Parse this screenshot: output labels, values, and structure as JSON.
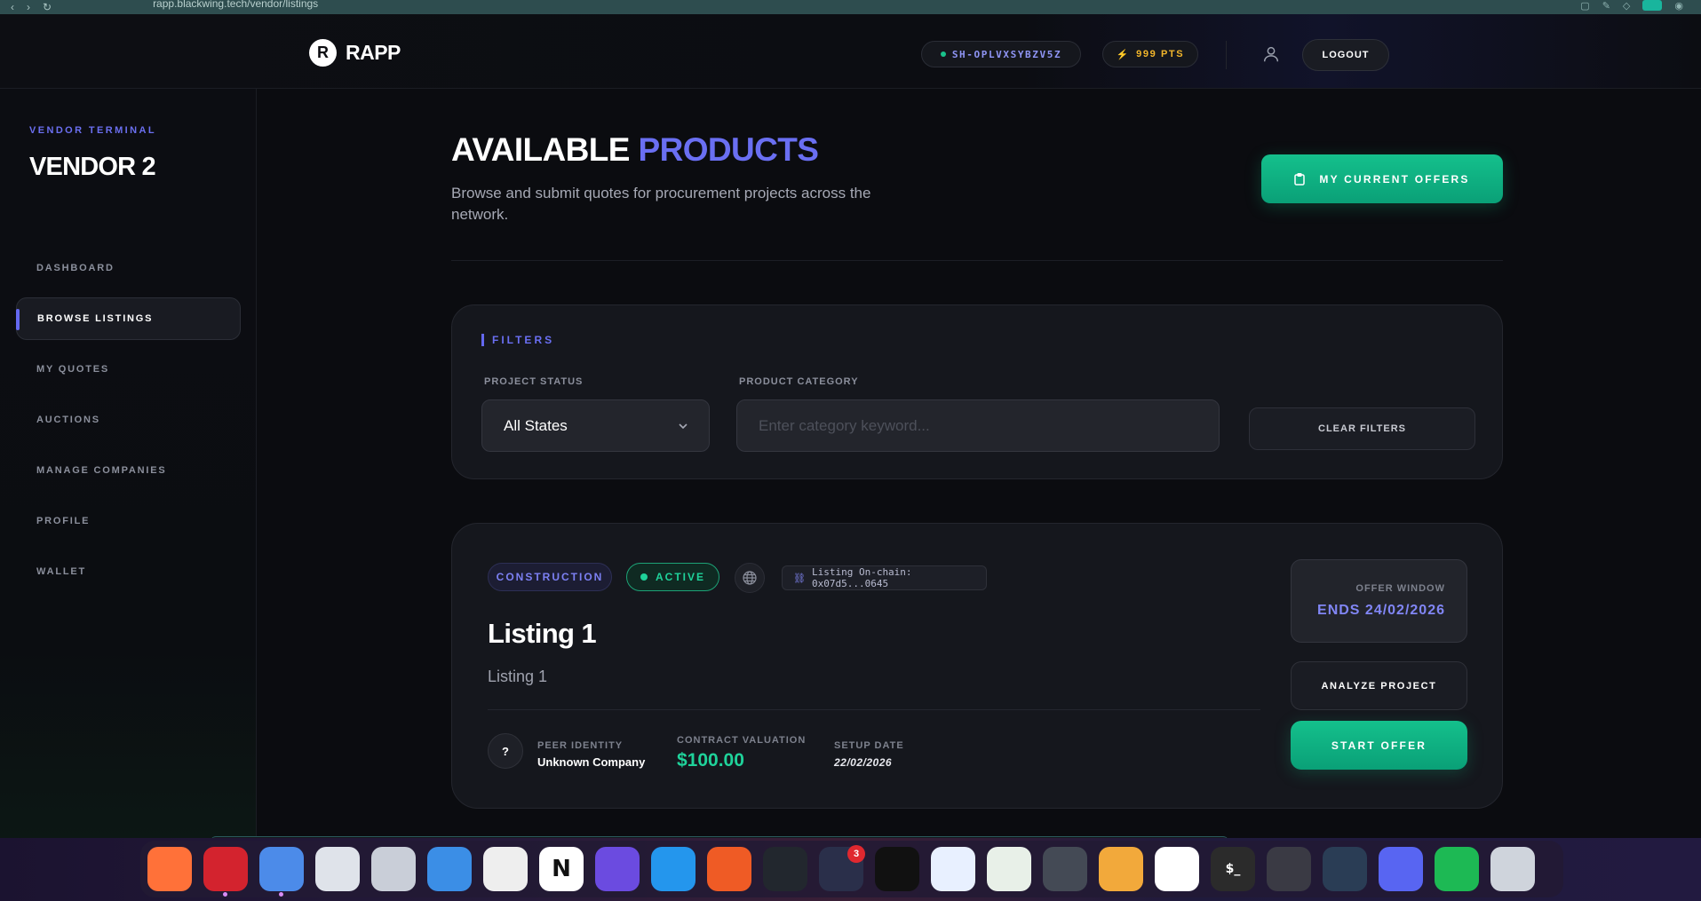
{
  "browser": {
    "url": "rapp.blackwing.tech/vendor/listings"
  },
  "topnav": {
    "brand_letter": "R",
    "brand_name": "RAPP",
    "session_id": "SH-OPLVXSYBZV5Z",
    "points": "999 PTS",
    "logout_label": "LOGOUT"
  },
  "sidebar": {
    "section_label": "VENDOR TERMINAL",
    "vendor_name": "VENDOR 2",
    "items": [
      {
        "label": "DASHBOARD",
        "active": false
      },
      {
        "label": "BROWSE LISTINGS",
        "active": true
      },
      {
        "label": "MY QUOTES",
        "active": false
      },
      {
        "label": "AUCTIONS",
        "active": false
      },
      {
        "label": "MANAGE COMPANIES",
        "active": false
      },
      {
        "label": "PROFILE",
        "active": false
      },
      {
        "label": "WALLET",
        "active": false
      }
    ]
  },
  "page": {
    "title_main": "AVAILABLE",
    "title_accent": "PRODUCTS",
    "subtitle": "Browse and submit quotes for procurement projects across the network.",
    "offers_button": "MY CURRENT OFFERS"
  },
  "filters": {
    "label": "FILTERS",
    "status_label": "PROJECT STATUS",
    "status_value": "All States",
    "category_label": "PRODUCT CATEGORY",
    "category_placeholder": "Enter category keyword...",
    "clear_label": "CLEAR FILTERS"
  },
  "listing": {
    "category": "CONSTRUCTION",
    "status": "ACTIVE",
    "chain": "Listing On-chain: 0x07d5...0645",
    "title": "Listing 1",
    "description": "Listing 1",
    "peer_label": "PEER IDENTITY",
    "peer_value": "Unknown Company",
    "peer_avatar": "?",
    "valuation_label": "CONTRACT VALUATION",
    "valuation_value": "$100.00",
    "setup_label": "SETUP DATE",
    "setup_value": "22/02/2026",
    "offer_window_label": "OFFER WINDOW",
    "offer_window_value": "ENDS 24/02/2026",
    "analyze_label": "ANALYZE PROJECT",
    "start_label": "START OFFER"
  },
  "colors": {
    "accent": "#6a6ff2",
    "success": "#10b981",
    "points": "#f2b62b"
  },
  "dock": {
    "items": [
      {
        "name": "firefox-icon",
        "glyph": "",
        "color": "#ff7139"
      },
      {
        "name": "opera-icon",
        "glyph": "",
        "color": "#d3232e",
        "running": true
      },
      {
        "name": "chromium-icon",
        "glyph": "",
        "color": "#4c8be9",
        "running": true
      },
      {
        "name": "files-icon",
        "glyph": "",
        "color": "#dfe3ea"
      },
      {
        "name": "archive-manager-icon",
        "glyph": "",
        "color": "#c9ced8"
      },
      {
        "name": "document-viewer-icon",
        "glyph": "",
        "color": "#3b8ee6"
      },
      {
        "name": "text-editor-icon",
        "glyph": "",
        "color": "#eeeeee"
      },
      {
        "name": "notion-icon",
        "glyph": "N",
        "color": "#ffffff"
      },
      {
        "name": "planner-icon",
        "glyph": "",
        "color": "#6b4be0"
      },
      {
        "name": "docker-icon",
        "glyph": "",
        "color": "#2496ed"
      },
      {
        "name": "postman-icon",
        "glyph": "",
        "color": "#ef5b25"
      },
      {
        "name": "vscode-icon",
        "glyph": "",
        "color": "#22272e"
      },
      {
        "name": "app-launcher-icon",
        "glyph": "",
        "color": "#2a2f4a",
        "badge": "3"
      },
      {
        "name": "intellij-icon",
        "glyph": "",
        "color": "#111111"
      },
      {
        "name": "android-studio-icon",
        "glyph": "",
        "color": "#e8f0ff"
      },
      {
        "name": "monitor-icon",
        "glyph": "",
        "color": "#e8f0e8"
      },
      {
        "name": "unity-icon",
        "glyph": "",
        "color": "#444a55"
      },
      {
        "name": "dbeaver-icon",
        "glyph": "",
        "color": "#f2a93b"
      },
      {
        "name": "mongodb-compass-icon",
        "glyph": "",
        "color": "#ffffff"
      },
      {
        "name": "terminal-icon",
        "glyph": "$_",
        "color": "#2b2b2b"
      },
      {
        "name": "toggle-icon",
        "glyph": "",
        "color": "#3a3a44"
      },
      {
        "name": "system-monitor-icon",
        "glyph": "",
        "color": "#2a3d55"
      },
      {
        "name": "discord-icon",
        "glyph": "",
        "color": "#5865f2"
      },
      {
        "name": "spotify-icon",
        "glyph": "",
        "color": "#1db954"
      },
      {
        "name": "trash-icon",
        "glyph": "",
        "color": "#cfd4dc"
      }
    ]
  }
}
